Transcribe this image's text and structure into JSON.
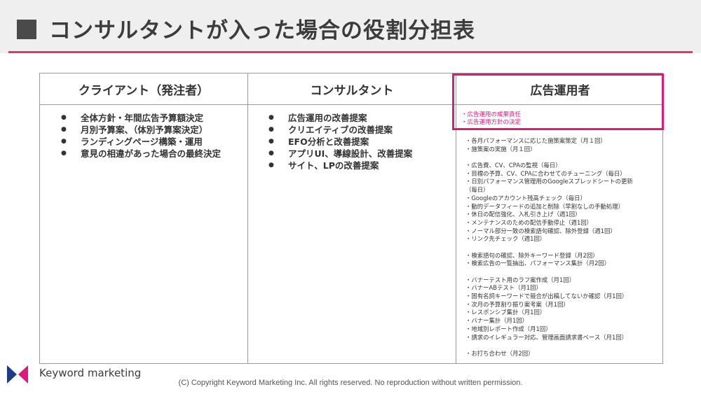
{
  "title": "コンサルタントが入った場合の役割分担表",
  "accent_color": "#e0187c",
  "table": {
    "columns": [
      {
        "header": "クライアント（発注者）",
        "items": [
          "全体方針・年間広告予算額決定",
          "月別予算案、（体別予算案決定）",
          "ランディングページ構築・運用",
          "意見の相違があった場合の最終決定"
        ]
      },
      {
        "header": "コンサルタント",
        "items": [
          "広告運用の改善提案",
          "クリエイティブの改善提案",
          "EFO分析と改善提案",
          "アプリUI、導線設計、改善提案",
          "サイト、LPの改善提案"
        ]
      },
      {
        "header": "広告運用者",
        "responsibilities": [
          "・広告運用の成果責任",
          "・広告運用方針の決定"
        ],
        "tasks": [
          "・各月パフォーマンスに応じた施策案策定（月１回）",
          "・施策案の実施（月１回）",
          "",
          "・広告費、CV、CPAの監視（毎日）",
          "・目標の予算、CV、CPAに合わせてのチューニング（毎日）",
          "・日別パフォーマンス管理用のGoogleスプレッドシートの更新",
          "（毎日）",
          "・Googleのアカウント残高チェック（毎日）",
          "・動的データフィードの追加と削除（早割なしの手動処理）",
          "・休日の配信強化、入札引き上げ（週1回）",
          "・メンテナンスのための配信手動停止（週1回）",
          "・ノーマル部分一致の検索語句確認、除外登録（週1回）",
          "・リンク先チェック（週1回）",
          "",
          "・検索語句の確認、除外キーワード登録（月2回）",
          "・検索広告の一覧抽出、パフォーマンス集計（月2回）",
          "",
          "・バナーテスト用のラフ案作成（月1回）",
          "・バナーABテスト（月1回）",
          "・固有名詞キーワードで競合が出稿してないか確認（月1回）",
          "・次月の予算割り振り案考案（月1回）",
          "・レスポンシブ集計（月1回）",
          "・バナー集計（月1回）",
          "・地域別レポート作成（月1回）",
          "・請求のイレギュラー対応、管理画面請求書ベース（月1回）",
          "",
          "・お打ち合わせ（月2回）"
        ]
      }
    ]
  },
  "footer": {
    "logo_text": "Keyword marketing",
    "copyright": "(C) Copyright Keyword Marketing Inc. All rights reserved. No reproduction without written permission."
  }
}
